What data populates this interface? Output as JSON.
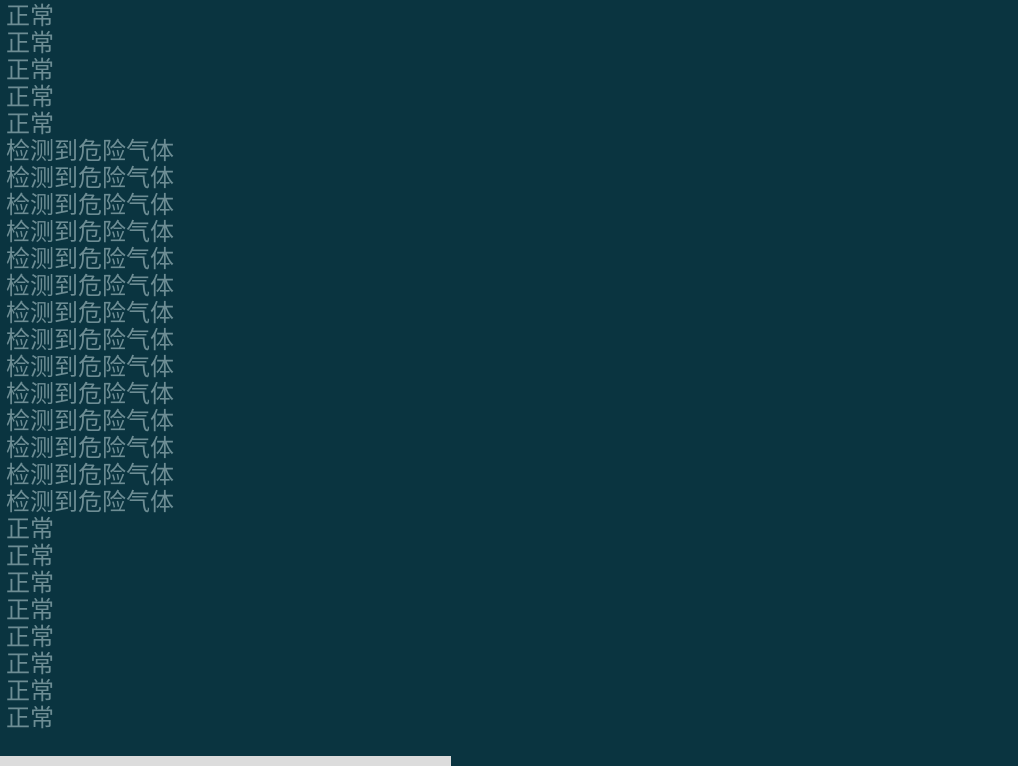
{
  "console": {
    "lines": [
      "正常",
      "正常",
      "正常",
      "正常",
      "正常",
      "检测到危险气体",
      "检测到危险气体",
      "检测到危险气体",
      "检测到危险气体",
      "检测到危险气体",
      "检测到危险气体",
      "检测到危险气体",
      "检测到危险气体",
      "检测到危险气体",
      "检测到危险气体",
      "检测到危险气体",
      "检测到危险气体",
      "检测到危险气体",
      "检测到危险气体",
      "正常",
      "正常",
      "正常",
      "正常",
      "正常",
      "正常",
      "正常",
      "正常"
    ]
  }
}
